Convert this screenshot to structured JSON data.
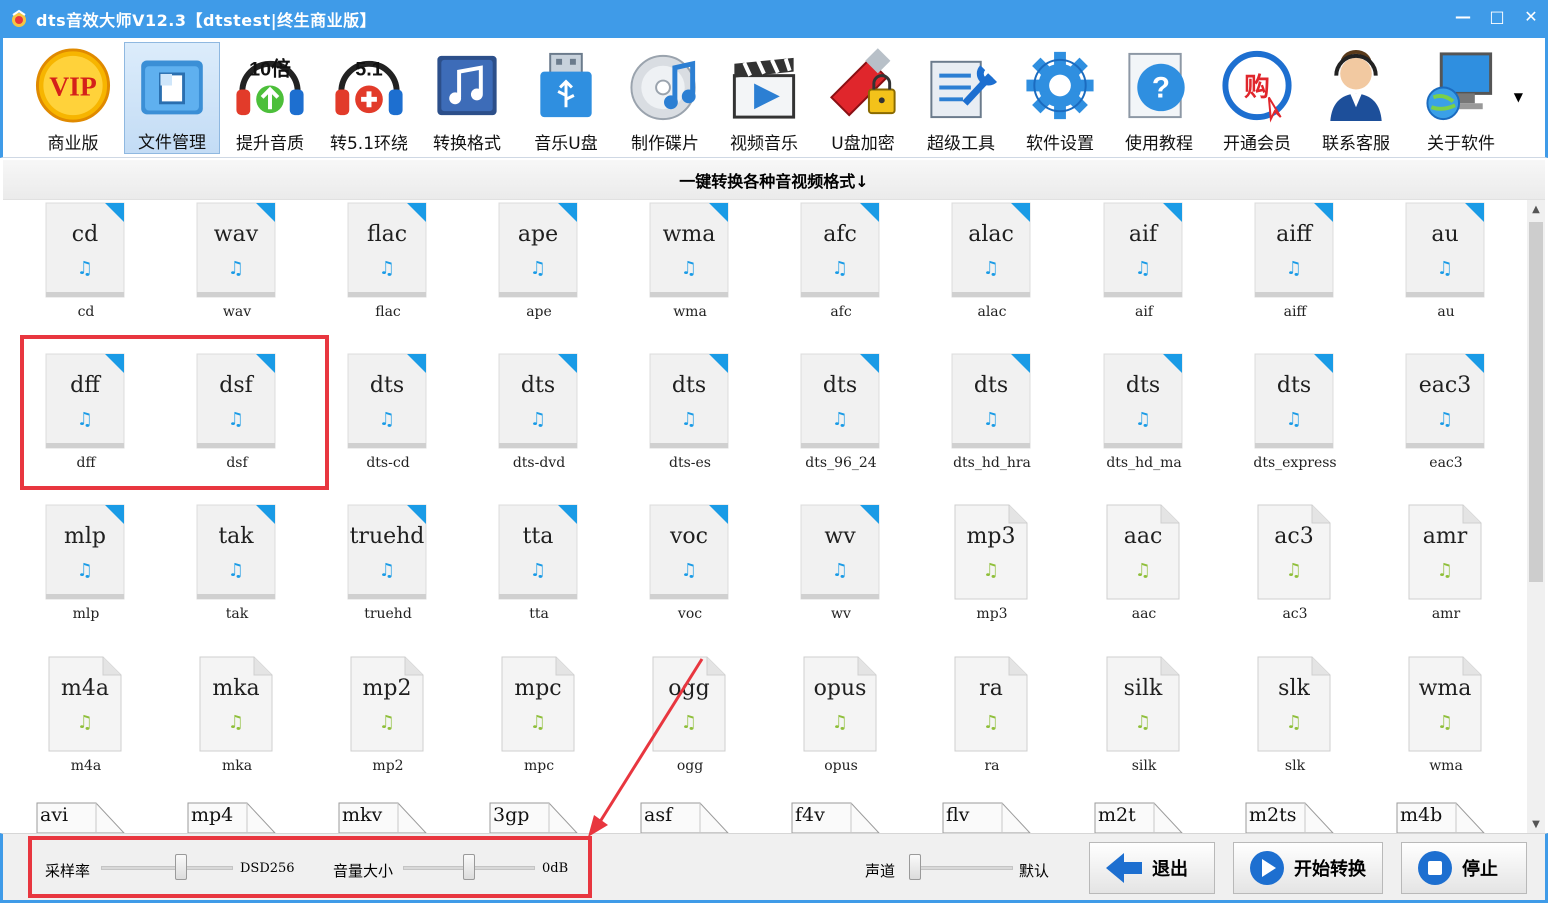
{
  "window": {
    "title": "dts音效大师V12.3【dtstest|终生商业版】",
    "controls": {
      "minimize": "—",
      "maximize": "□",
      "close": "✕"
    }
  },
  "toolbar": {
    "items": [
      {
        "label": "商业版",
        "icon": "vip-badge-icon"
      },
      {
        "label": "文件管理",
        "icon": "folder-icon",
        "active": true
      },
      {
        "label": "提升音质",
        "icon": "headphones-boost-icon",
        "badge": "10倍"
      },
      {
        "label": "转5.1环绕",
        "icon": "headphones-surround-icon",
        "badge": "5.1"
      },
      {
        "label": "转换格式",
        "icon": "music-convert-icon"
      },
      {
        "label": "音乐U盘",
        "icon": "usb-drive-icon"
      },
      {
        "label": "制作碟片",
        "icon": "disc-icon"
      },
      {
        "label": "视频音乐",
        "icon": "clapperboard-icon"
      },
      {
        "label": "U盘加密",
        "icon": "usb-lock-icon"
      },
      {
        "label": "超级工具",
        "icon": "tools-icon"
      },
      {
        "label": "软件设置",
        "icon": "gear-icon"
      },
      {
        "label": "使用教程",
        "icon": "help-icon"
      },
      {
        "label": "开通会员",
        "icon": "shop-icon",
        "badge": "购"
      },
      {
        "label": "联系客服",
        "icon": "support-agent-icon"
      },
      {
        "label": "关于软件",
        "icon": "computer-icon"
      }
    ]
  },
  "section": {
    "title": "一键转换各种音视频格式↓"
  },
  "formats": [
    [
      {
        "ext": "cd",
        "caption": "cd",
        "kind": "lossless"
      },
      {
        "ext": "wav",
        "caption": "wav",
        "kind": "lossless"
      },
      {
        "ext": "flac",
        "caption": "flac",
        "kind": "lossless"
      },
      {
        "ext": "ape",
        "caption": "ape",
        "kind": "lossless"
      },
      {
        "ext": "wma",
        "caption": "wma",
        "kind": "lossless"
      },
      {
        "ext": "afc",
        "caption": "afc",
        "kind": "lossless"
      },
      {
        "ext": "alac",
        "caption": "alac",
        "kind": "lossless"
      },
      {
        "ext": "aif",
        "caption": "aif",
        "kind": "lossless"
      },
      {
        "ext": "aiff",
        "caption": "aiff",
        "kind": "lossless"
      },
      {
        "ext": "au",
        "caption": "au",
        "kind": "lossless"
      }
    ],
    [
      {
        "ext": "dff",
        "caption": "dff",
        "kind": "lossless"
      },
      {
        "ext": "dsf",
        "caption": "dsf",
        "kind": "lossless"
      },
      {
        "ext": "dts",
        "caption": "dts-cd",
        "kind": "lossless"
      },
      {
        "ext": "dts",
        "caption": "dts-dvd",
        "kind": "lossless"
      },
      {
        "ext": "dts",
        "caption": "dts-es",
        "kind": "lossless"
      },
      {
        "ext": "dts",
        "caption": "dts_96_24",
        "kind": "lossless"
      },
      {
        "ext": "dts",
        "caption": "dts_hd_hra",
        "kind": "lossless"
      },
      {
        "ext": "dts",
        "caption": "dts_hd_ma",
        "kind": "lossless"
      },
      {
        "ext": "dts",
        "caption": "dts_express",
        "kind": "lossless"
      },
      {
        "ext": "eac3",
        "caption": "eac3",
        "kind": "lossless"
      }
    ],
    [
      {
        "ext": "mlp",
        "caption": "mlp",
        "kind": "lossless"
      },
      {
        "ext": "tak",
        "caption": "tak",
        "kind": "lossless"
      },
      {
        "ext": "truehd",
        "caption": "truehd",
        "kind": "lossless"
      },
      {
        "ext": "tta",
        "caption": "tta",
        "kind": "lossless"
      },
      {
        "ext": "voc",
        "caption": "voc",
        "kind": "lossless"
      },
      {
        "ext": "wv",
        "caption": "wv",
        "kind": "lossless"
      },
      {
        "ext": "mp3",
        "caption": "mp3",
        "kind": "lossy"
      },
      {
        "ext": "aac",
        "caption": "aac",
        "kind": "lossy"
      },
      {
        "ext": "ac3",
        "caption": "ac3",
        "kind": "lossy"
      },
      {
        "ext": "amr",
        "caption": "amr",
        "kind": "lossy"
      }
    ],
    [
      {
        "ext": "m4a",
        "caption": "m4a",
        "kind": "lossy"
      },
      {
        "ext": "mka",
        "caption": "mka",
        "kind": "lossy"
      },
      {
        "ext": "mp2",
        "caption": "mp2",
        "kind": "lossy"
      },
      {
        "ext": "mpc",
        "caption": "mpc",
        "kind": "lossy"
      },
      {
        "ext": "ogg",
        "caption": "ogg",
        "kind": "lossy"
      },
      {
        "ext": "opus",
        "caption": "opus",
        "kind": "lossy"
      },
      {
        "ext": "ra",
        "caption": "ra",
        "kind": "lossy"
      },
      {
        "ext": "silk",
        "caption": "silk",
        "kind": "lossy"
      },
      {
        "ext": "slk",
        "caption": "slk",
        "kind": "lossy"
      },
      {
        "ext": "wma",
        "caption": "wma",
        "kind": "lossy"
      }
    ]
  ],
  "video_formats": [
    "avi",
    "mp4",
    "mkv",
    "3gp",
    "asf",
    "f4v",
    "flv",
    "m2t",
    "m2ts",
    "m4b"
  ],
  "controls": {
    "sample_rate": {
      "label": "采样率",
      "value": "DSD256",
      "level": 0.62
    },
    "volume": {
      "label": "音量大小",
      "value": "0dB",
      "level": 0.5
    },
    "channel": {
      "label": "声道",
      "value": "默认",
      "level": 0.0
    }
  },
  "buttons": {
    "exit": "退出",
    "start": "开始转换",
    "stop": "停止"
  },
  "colors": {
    "titlebar": "#3f9be8",
    "highlight": "#e8363f",
    "lossless_note": "#1a9be6",
    "lossy_note": "#8fbf3a"
  }
}
